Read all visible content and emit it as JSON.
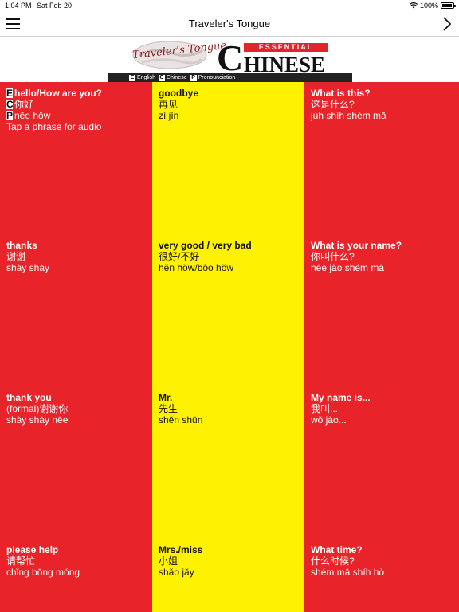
{
  "status": {
    "time": "1:04 PM",
    "date": "Sat Feb 20",
    "battery": "100%"
  },
  "nav": {
    "title": "Traveler's Tongue"
  },
  "banner": {
    "script_logo": "Traveler's Tongue",
    "essential": "ESSENTIAL",
    "big_c": "C",
    "rest": "HINESE",
    "legend": [
      {
        "key": "E",
        "label": "English"
      },
      {
        "key": "C",
        "label": "Chinese"
      },
      {
        "key": "P",
        "label": "Pronounciation"
      }
    ]
  },
  "phrases": [
    {
      "en": "hello/How are you?",
      "zh": "你好",
      "py": "nēe hǒw",
      "hint": "Tap a phrase for audio",
      "keys": [
        "E",
        "C",
        "P"
      ]
    },
    {
      "en": "goodbye",
      "zh": "再见",
      "py": "zì jìn"
    },
    {
      "en": "What is this?",
      "zh": "这是什么?",
      "py": "jùh shìh shém mā"
    },
    {
      "en": "thanks",
      "zh": "谢谢",
      "py": "shày shày"
    },
    {
      "en": "very good / very bad",
      "zh": "很好/不好",
      "py": "hěn hǒw/bòo hǒw"
    },
    {
      "en": "What is your name?",
      "zh": "你叫什么?",
      "py": "nēe jào shém mā"
    },
    {
      "en": "thank you",
      "zh": "(formal)谢谢你",
      "py": "shày shày nēe"
    },
    {
      "en": "Mr.",
      "zh": "先生",
      "py": "shēn shūn"
    },
    {
      "en": "My name is...",
      "zh": "我叫...",
      "py": "wǒ jào..."
    },
    {
      "en": "please help",
      "zh": "请帮忙",
      "py": "chǐng bōng móng"
    },
    {
      "en": "Mrs./miss",
      "zh": "小姐",
      "py": "shǎo jǎy"
    },
    {
      "en": "What time?",
      "zh": "什么时候?",
      "py": "shém mā shíh hò"
    }
  ],
  "colors": {
    "red": "#e8232a",
    "yellow": "#fff200"
  }
}
